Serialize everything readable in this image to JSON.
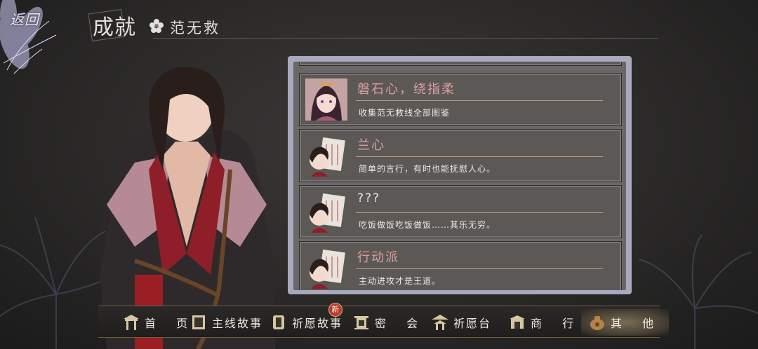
{
  "header": {
    "back_label": "返回",
    "title": "成就",
    "subtitle": "范无救"
  },
  "achievements": [
    {
      "name": "磐石心，绕指柔",
      "description": "收集范无救线全部图鉴",
      "avatar": "girl-portrait",
      "locked_name": false
    },
    {
      "name": "兰心",
      "description": "简单的言行，有时也能抚慰人心。",
      "avatar": "chibi-scroll",
      "locked_name": false
    },
    {
      "name": "???",
      "description": "吃饭做饭吃饭做饭……其乐无穷。",
      "avatar": "chibi-scroll",
      "locked_name": true
    },
    {
      "name": "行动派",
      "description": "主动进攻才是王道。",
      "avatar": "chibi-scroll",
      "locked_name": false
    }
  ],
  "nav": {
    "items": [
      {
        "label": "首 页",
        "icon": "gate-icon"
      },
      {
        "label": "主线故事",
        "icon": "book-icon"
      },
      {
        "label": "祈愿故事",
        "icon": "scroll-icon",
        "badge": "新"
      },
      {
        "label": "密 会",
        "icon": "lantern-icon"
      },
      {
        "label": "祈愿台",
        "icon": "pavilion-icon"
      },
      {
        "label": "商 行",
        "icon": "shop-icon"
      },
      {
        "label": "其 他",
        "icon": "pouch-icon",
        "active": true
      }
    ]
  },
  "colors": {
    "accent_pink": "#d99fa0",
    "panel_frame": "#a8a9bd",
    "nav_gold": "#6e5d43",
    "badge_red": "#b83a2c"
  }
}
